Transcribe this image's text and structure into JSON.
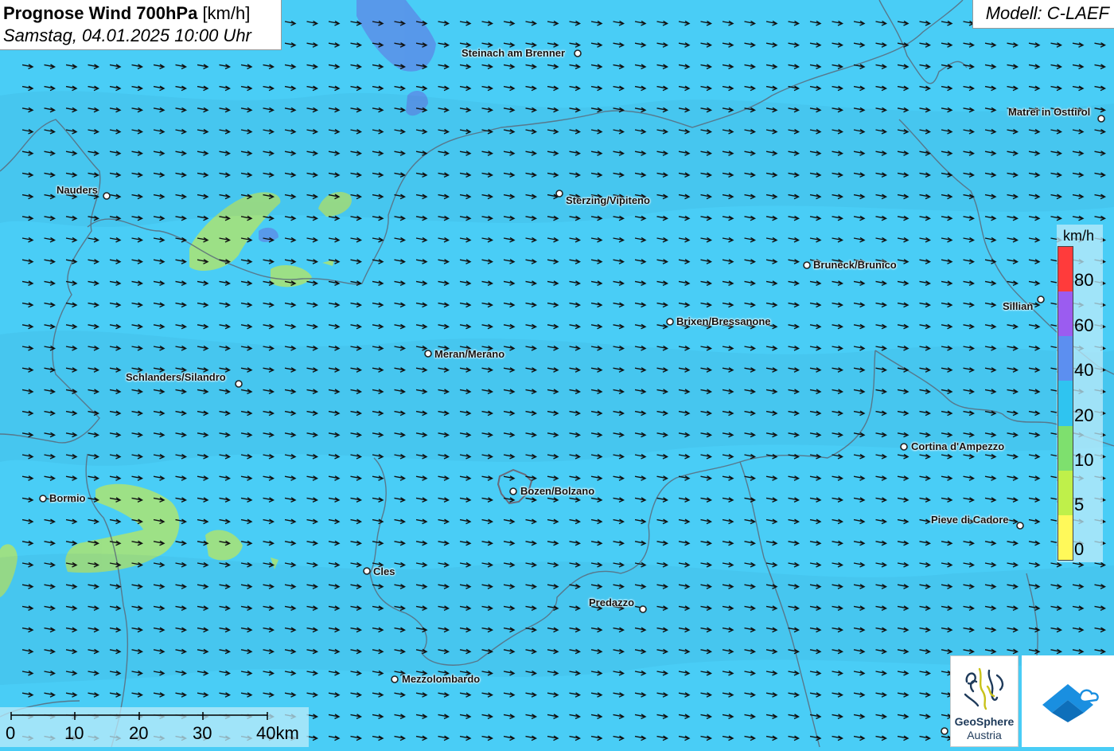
{
  "header": {
    "title_bold": "Prognose Wind 700hPa",
    "title_unit": "[km/h]",
    "subtitle": "Samstag, 04.01.2025 10:00 Uhr",
    "model": "Modell: C-LAEF"
  },
  "places": [
    {
      "name": "Steinach am Brenner",
      "align": "left"
    },
    {
      "name": "Matrei in Osttirol",
      "align": "left"
    },
    {
      "name": "Nauders",
      "align": "left"
    },
    {
      "name": "Sterzing/Vipiteno",
      "align": "right"
    },
    {
      "name": "Bruneck/Brunico",
      "align": "right"
    },
    {
      "name": "Sillian",
      "align": "left"
    },
    {
      "name": "Brixen/Bressanone",
      "align": "right"
    },
    {
      "name": "Meran/Merano",
      "align": "right"
    },
    {
      "name": "Schlanders/Silandro",
      "align": "left"
    },
    {
      "name": "Cortina d'Ampezzo",
      "align": "right"
    },
    {
      "name": "Bormio",
      "align": "right"
    },
    {
      "name": "Bozen/Bolzano",
      "align": "right"
    },
    {
      "name": "Pieve di Cadore",
      "align": "left"
    },
    {
      "name": "Cles",
      "align": "right"
    },
    {
      "name": "Predazzo",
      "align": "left"
    },
    {
      "name": "Mezzolombardo",
      "align": "right"
    }
  ],
  "legend": {
    "unit": "km/h",
    "ticks": [
      "80",
      "60",
      "40",
      "20",
      "10",
      "5",
      "0"
    ],
    "colors": [
      "#ff3b3b",
      "#9b5cf0",
      "#5c8ff0",
      "#2fc4f0",
      "#7ee06e",
      "#bff04a",
      "#fff95a"
    ]
  },
  "scale_bar": {
    "labels": [
      "0",
      "10",
      "20",
      "30",
      "40km"
    ]
  },
  "logo": {
    "name": "GeoSphere",
    "country": "Austria"
  },
  "wind": {
    "direction": "east-southeast",
    "dominant_speed_band": "20-40",
    "field_color": "#49cdf6",
    "weak_wind_color": "#a6e37a",
    "strong_wind_color": "#5a8fe8"
  }
}
